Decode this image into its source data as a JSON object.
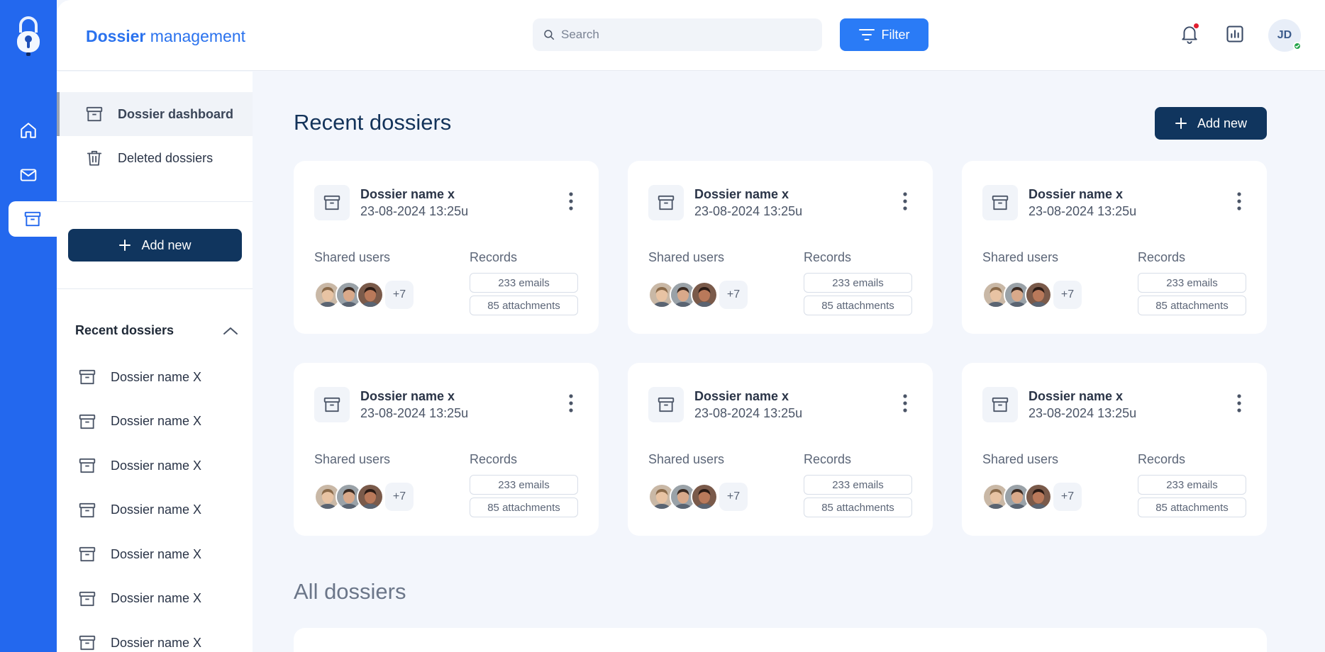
{
  "app": {
    "title_bold": "Dossier",
    "title_rest": " management"
  },
  "search": {
    "placeholder": "Search",
    "value": ""
  },
  "filter": {
    "label": "Filter"
  },
  "user": {
    "initials": "JD",
    "status": "online"
  },
  "colors": {
    "rail": "#2368ee",
    "accent": "#2a7bf6",
    "dark_button": "#10355e",
    "notification": "#e11d2e",
    "online": "#22a34a"
  },
  "rail": {
    "items": [
      {
        "icon": "home-icon"
      },
      {
        "icon": "mail-icon"
      },
      {
        "icon": "archive-icon",
        "active": true
      }
    ]
  },
  "sidebar": {
    "nav": [
      {
        "label": "Dossier dashboard",
        "icon": "archive-icon",
        "active": true
      },
      {
        "label": "Deleted dossiers",
        "icon": "trash-icon"
      }
    ],
    "add_new": "Add new",
    "recent_title": "Recent dossiers",
    "recent": [
      "Dossier name X",
      "Dossier name X",
      "Dossier name X",
      "Dossier name X",
      "Dossier name X",
      "Dossier name X",
      "Dossier name X"
    ]
  },
  "main": {
    "recent_title": "Recent dossiers",
    "add_new": "Add new",
    "all_title": "All dossiers",
    "cards": [
      {
        "name": "Dossier name x",
        "date": "23-08-2024 13:25u",
        "shared_label": "Shared users",
        "more_users": "+7",
        "records_label": "Records",
        "emails": "233 emails",
        "attachments": "85 attachments"
      },
      {
        "name": "Dossier name x",
        "date": "23-08-2024 13:25u",
        "shared_label": "Shared users",
        "more_users": "+7",
        "records_label": "Records",
        "emails": "233 emails",
        "attachments": "85 attachments"
      },
      {
        "name": "Dossier name x",
        "date": "23-08-2024 13:25u",
        "shared_label": "Shared users",
        "more_users": "+7",
        "records_label": "Records",
        "emails": "233 emails",
        "attachments": "85 attachments"
      },
      {
        "name": "Dossier name x",
        "date": "23-08-2024 13:25u",
        "shared_label": "Shared users",
        "more_users": "+7",
        "records_label": "Records",
        "emails": "233 emails",
        "attachments": "85 attachments"
      },
      {
        "name": "Dossier name x",
        "date": "23-08-2024 13:25u",
        "shared_label": "Shared users",
        "more_users": "+7",
        "records_label": "Records",
        "emails": "233 emails",
        "attachments": "85 attachments"
      },
      {
        "name": "Dossier name x",
        "date": "23-08-2024 13:25u",
        "shared_label": "Shared users",
        "more_users": "+7",
        "records_label": "Records",
        "emails": "233 emails",
        "attachments": "85 attachments"
      }
    ]
  }
}
